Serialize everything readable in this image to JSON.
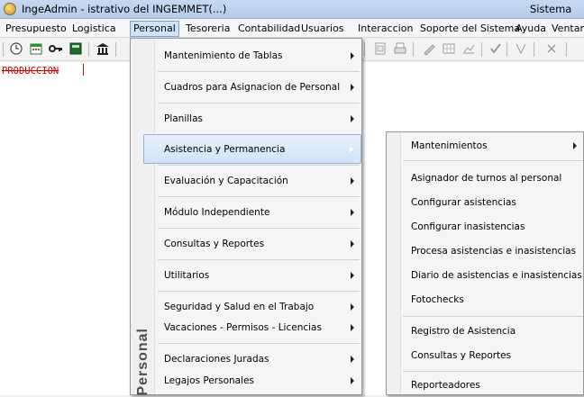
{
  "window": {
    "title": "IngeAdmin - istrativo del INGEMMET(...)",
    "title_right": "Sistema"
  },
  "menubar": {
    "items": [
      {
        "label": "Presupuesto"
      },
      {
        "label": "Logistica"
      },
      {
        "label": "Personal"
      },
      {
        "label": "Tesoreria"
      },
      {
        "label": "Contabilidad"
      },
      {
        "label": "Usuarios"
      },
      {
        "label": "Interaccion"
      },
      {
        "label": "Soporte del Sistema"
      },
      {
        "label": "Ayuda"
      },
      {
        "label": "Ventan"
      }
    ],
    "active": "Personal"
  },
  "toolbar": {
    "icons": [
      "clock-icon",
      "calendar-icon",
      "key-icon",
      "calculator-icon",
      "building-icon",
      "print-preview-icon",
      "printer-icon",
      "pen-icon",
      "grid-icon",
      "chart-icon",
      "check-icon",
      "filter-icon",
      "close-icon"
    ]
  },
  "workspace": {
    "environment_label": "PRODUCCION"
  },
  "personal_menu": {
    "caption": "Personal",
    "items": [
      {
        "label": "Mantenimiento de Tablas",
        "submenu": true
      },
      {
        "label": "Cuadros para Asignacion de Personal",
        "submenu": true
      },
      {
        "label": "Planillas",
        "submenu": true
      },
      {
        "label": "Asistencia y Permanencia",
        "submenu": true,
        "highlighted": true
      },
      {
        "label": "Evaluación y Capacitación",
        "submenu": true
      },
      {
        "label": "Módulo Independiente",
        "submenu": true
      },
      {
        "label": "Consultas y Reportes",
        "submenu": true
      },
      {
        "label": "Utilitarios",
        "submenu": true
      },
      {
        "label": "Seguridad y Salud en el Trabajo",
        "submenu": true
      },
      {
        "label": "Vacaciones - Permisos - Licencias",
        "submenu": true
      },
      {
        "label": "Declaraciones Juradas",
        "submenu": true
      },
      {
        "label": "Legajos Personales",
        "submenu": true
      }
    ]
  },
  "asistencia_submenu": {
    "items": [
      {
        "label": "Mantenimientos",
        "submenu": true
      },
      {
        "label": "Asignador de turnos al personal"
      },
      {
        "label": "Configurar asistencias"
      },
      {
        "label": "Configurar inasistencias"
      },
      {
        "label": "Procesa asistencias e inasistencias"
      },
      {
        "label": "Diario de asistencias e inasistencias"
      },
      {
        "label": "Fotochecks"
      },
      {
        "label": "Registro de Asistencia"
      },
      {
        "label": "Consultas y Reportes"
      },
      {
        "label": "Reporteadores"
      }
    ]
  },
  "colors": {
    "highlight": "#cfe3f7",
    "production_label": "#d30000"
  }
}
